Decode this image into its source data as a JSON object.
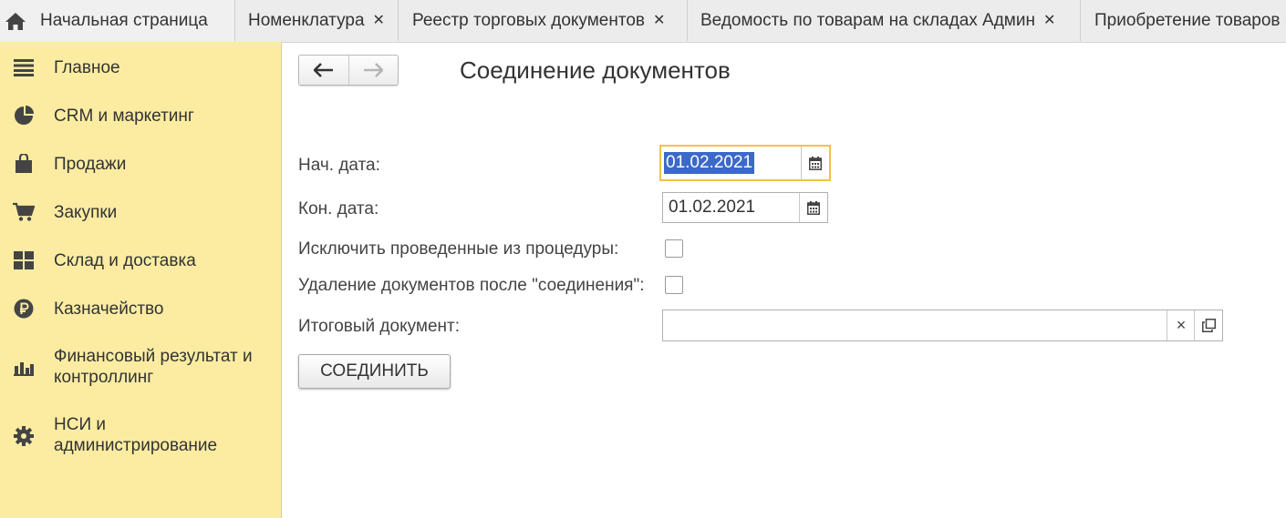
{
  "tabs": [
    {
      "label": "Начальная страница",
      "closable": false,
      "icon": "home-icon"
    },
    {
      "label": "Номенклатура",
      "closable": true
    },
    {
      "label": "Реестр торговых документов",
      "closable": true
    },
    {
      "label": "Ведомость по товарам на складах Админ",
      "closable": true
    },
    {
      "label": "Приобретение товаров",
      "closable": false
    }
  ],
  "tab_close_glyph": "✕",
  "sidebar": {
    "items": [
      {
        "label": "Главное",
        "icon": "menu-lines-icon"
      },
      {
        "label": "CRM и маркетинг",
        "icon": "pie-chart-icon"
      },
      {
        "label": "Продажи",
        "icon": "shopping-bag-icon"
      },
      {
        "label": "Закупки",
        "icon": "shopping-cart-icon"
      },
      {
        "label": "Склад и доставка",
        "icon": "warehouse-grid-icon"
      },
      {
        "label": "Казначейство",
        "icon": "ruble-coin-icon"
      },
      {
        "label": "Финансовый результат и\nконтроллинг",
        "icon": "bar-chart-icon"
      },
      {
        "label": "НСИ и\nадминистрирование",
        "icon": "gear-icon"
      }
    ],
    "background": "#fbeca2"
  },
  "form": {
    "title": "Соединение документов",
    "start_date": {
      "label": "Нач. дата:",
      "value": "01.02.2021"
    },
    "end_date": {
      "label": "Кон. дата:",
      "value": "01.02.2021"
    },
    "exclude_posted": {
      "label": "Исключить проведенные из процедуры:",
      "checked": false
    },
    "delete_after_join": {
      "label": "Удаление документов после \"соединения\":",
      "checked": false
    },
    "result_document": {
      "label": "Итоговый документ:",
      "value": ""
    },
    "join_button": "СОЕДИНИТЬ",
    "clear_glyph": "×"
  },
  "colors": {
    "focus_border": "#f1c24a",
    "selection": "#3b69c9",
    "tabbar": "#ececec"
  }
}
